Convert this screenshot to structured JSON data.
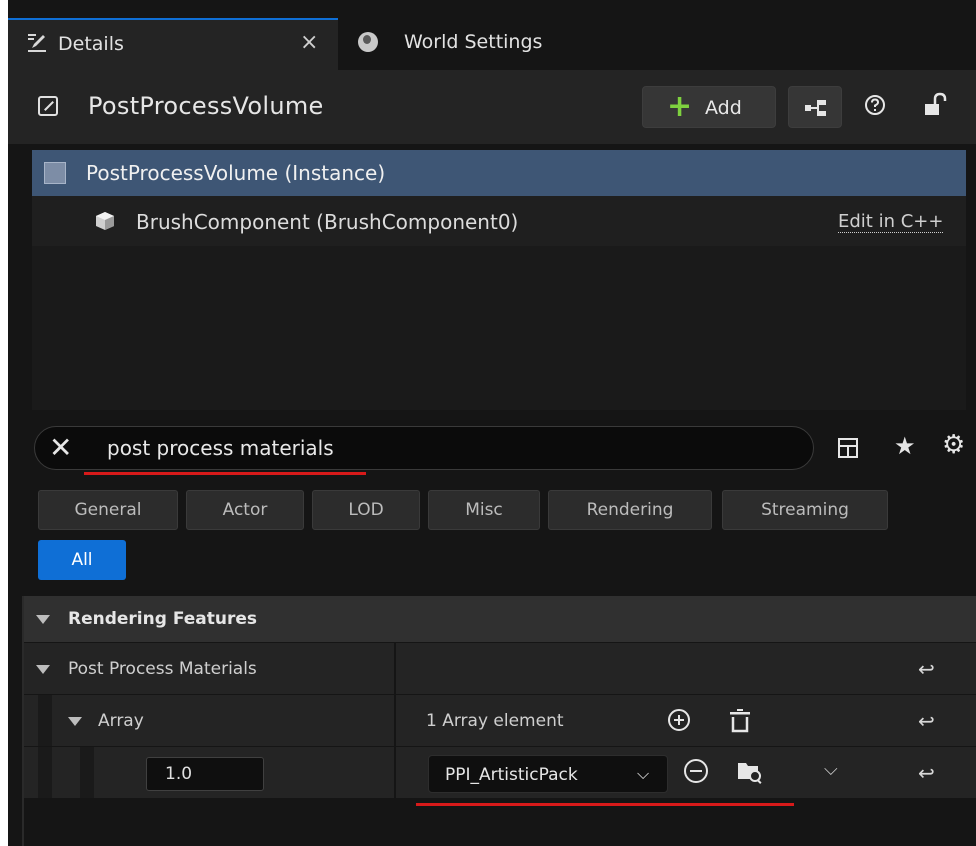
{
  "tabs": {
    "details_label": "Details",
    "close_glyph": "×",
    "world_label": "World Settings"
  },
  "header": {
    "title": "PostProcessVolume",
    "add_label": "Add"
  },
  "tree": {
    "instance_label": "PostProcessVolume (Instance)",
    "brush_label": "BrushComponent (BrushComponent0)",
    "edit_link": "Edit in C++"
  },
  "search": {
    "value": "post process materials"
  },
  "filters": {
    "chips": [
      "General",
      "Actor",
      "LOD",
      "Misc",
      "Rendering",
      "Streaming"
    ],
    "active": "All"
  },
  "properties": {
    "category": "Rendering Features",
    "group": "Post Process Materials",
    "array_label": "Array",
    "array_count": "1 Array element",
    "element_weight": "1.0",
    "element_asset": "PPI_ArtisticPack"
  },
  "colors": {
    "accent": "#0f6fd6",
    "selected_row": "#3e5675",
    "add_plus": "#7ed13f",
    "highlight_red": "#d71a1a"
  },
  "icons": [
    "pencil-icon",
    "globe-icon",
    "actor-icon",
    "plus-icon",
    "blueprint-icon",
    "help-icon",
    "lock-icon",
    "cube-icon",
    "brush-icon",
    "clear-icon",
    "grid-icon",
    "star-icon",
    "gear-icon",
    "collapse-arrow-icon",
    "reset-icon",
    "add-element-icon",
    "trash-icon",
    "use-selected-icon",
    "browse-icon",
    "chevron-down-icon"
  ]
}
